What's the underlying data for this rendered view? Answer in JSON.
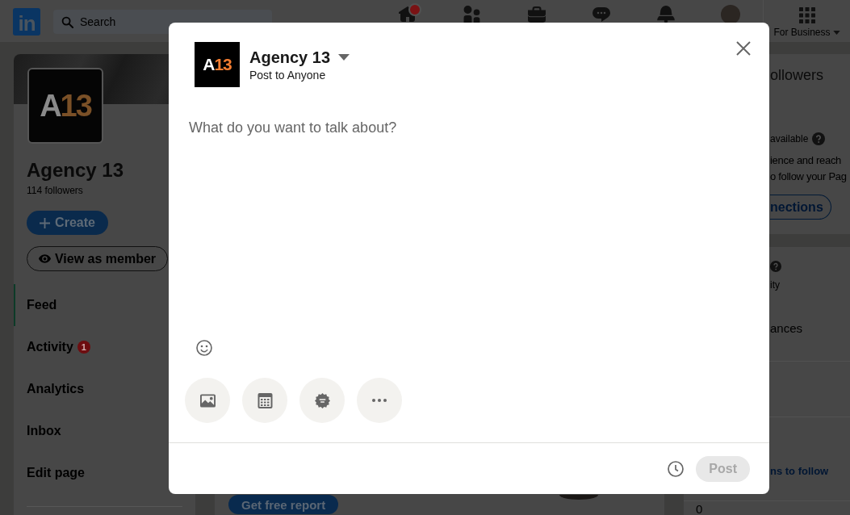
{
  "top_nav": {
    "logo": "in",
    "search": {
      "placeholder": "Search"
    },
    "nav_items": [
      {
        "kind": "home",
        "notification": true
      },
      {
        "kind": "network",
        "notification": false
      },
      {
        "kind": "jobs",
        "notification": false
      },
      {
        "kind": "messaging",
        "notification": false
      },
      {
        "kind": "notifications",
        "notification": false
      },
      {
        "kind": "profile",
        "notification": false
      }
    ],
    "business_menu": {
      "label": "For Business"
    }
  },
  "sidebar": {
    "logo": [
      {
        "text": "A",
        "color": "#8a8a8a"
      },
      {
        "text": "13",
        "color": "#7a5027"
      }
    ],
    "name": "Agency 13",
    "followers": "114 followers",
    "create_button": "Create",
    "view_button": "View as member",
    "nav": [
      {
        "label": "Feed",
        "selected": true
      },
      {
        "label": "Activity",
        "selected": false,
        "badge": "1"
      },
      {
        "label": "Analytics",
        "selected": false
      },
      {
        "label": "Inbox",
        "selected": false
      },
      {
        "label": "Edit page",
        "selected": false
      }
    ]
  },
  "main": {
    "report_button": "Get free report"
  },
  "right_panel": {
    "title": "ollowers",
    "notice": "available",
    "description": [
      "ience and reach",
      "o follow your Pag"
    ],
    "invite_button": "nections",
    "stat_caption": "ity",
    "stat_label": "ances",
    "link": "ns to follow",
    "count": "0"
  },
  "composer": {
    "logo": [
      {
        "text": "A",
        "color": "#ffffff"
      },
      {
        "text": "13",
        "color": "#f47d31"
      }
    ],
    "author": "Agency 13",
    "visibility": "Post to Anyone",
    "placeholder": "What do you want to talk about?",
    "post_button": {
      "label": "Post",
      "disabled": true
    }
  }
}
